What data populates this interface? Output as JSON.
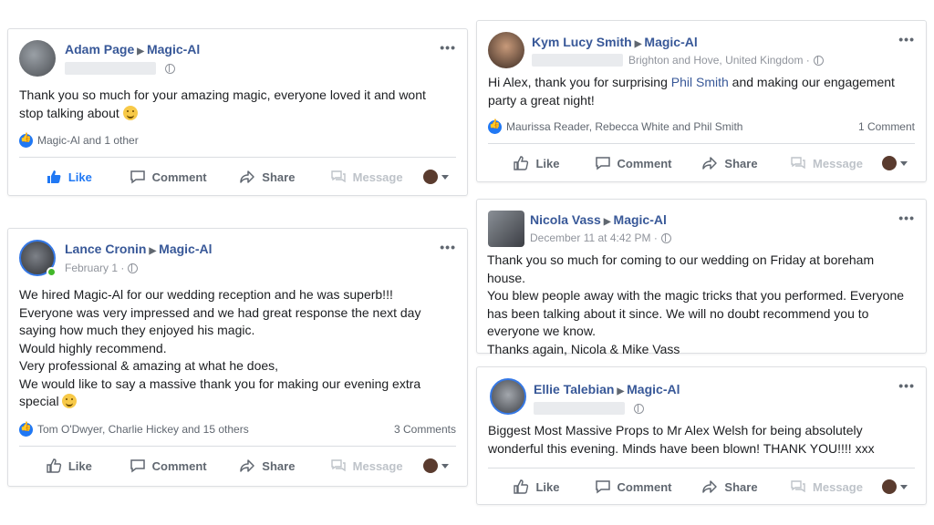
{
  "posts": [
    {
      "author": "Adam Page",
      "page": "Magic-Al",
      "meta": "",
      "body": [
        "Thank you so much for your amazing magic, everyone loved it and wont",
        "stop talking about"
      ],
      "reactions": "Magic-Al and 1 other",
      "comments": ""
    },
    {
      "author": "Lance Cronin",
      "page": "Magic-Al",
      "meta": "February 1 ·",
      "body": [
        "We hired Magic-Al for our wedding reception and he was superb!!!",
        "Everyone was very impressed and we had great response the next day",
        "saying how much they enjoyed his magic.",
        "Would highly recommend.",
        "Very professional & amazing at what he does,",
        "We would like to say a massive thank you for making our evening extra",
        "special"
      ],
      "reactions": "Tom O'Dwyer, Charlie Hickey and 15 others",
      "comments": "3 Comments"
    },
    {
      "author": "Kym Lucy Smith",
      "page": "Magic-Al",
      "meta": "Brighton and Hove, United Kingdom ·",
      "body_pre": "Hi Alex, thank you for surprising ",
      "body_mention": "Phil Smith",
      "body_post": " and making our engagement",
      "body_line2": "party a great night!",
      "reactions": "Maurissa Reader, Rebecca White and Phil Smith",
      "comments": "1 Comment"
    },
    {
      "author": "Nicola Vass",
      "page": "Magic-Al",
      "meta": "December 11 at 4:42 PM ·",
      "body": [
        "Thank you so much for coming to our wedding on Friday at boreham house.",
        "You blew people away with the magic tricks that you performed. Everyone",
        "has been talking about it since. We will no doubt recommend you to",
        "everyone we know.",
        "Thanks again, Nicola & Mike Vass"
      ]
    },
    {
      "author": "Ellie Talebian",
      "page": "Magic-Al",
      "meta": "",
      "body": [
        "Biggest Most Massive Props to Mr Alex Welsh for being absolutely",
        "wonderful this evening. Minds have been blown! THANK YOU!!!! xxx"
      ]
    }
  ],
  "actions": {
    "like": "Like",
    "comment": "Comment",
    "share": "Share",
    "message": "Message",
    "more": "•••"
  },
  "icons": {
    "like": "thumbs-up-icon",
    "comment": "speech-bubble-icon",
    "share": "share-arrow-icon",
    "message": "messenger-icon",
    "privacy": "globe-icon"
  },
  "colors": {
    "link": "#385898",
    "like_active": "#2078f4",
    "muted": "#606770"
  }
}
